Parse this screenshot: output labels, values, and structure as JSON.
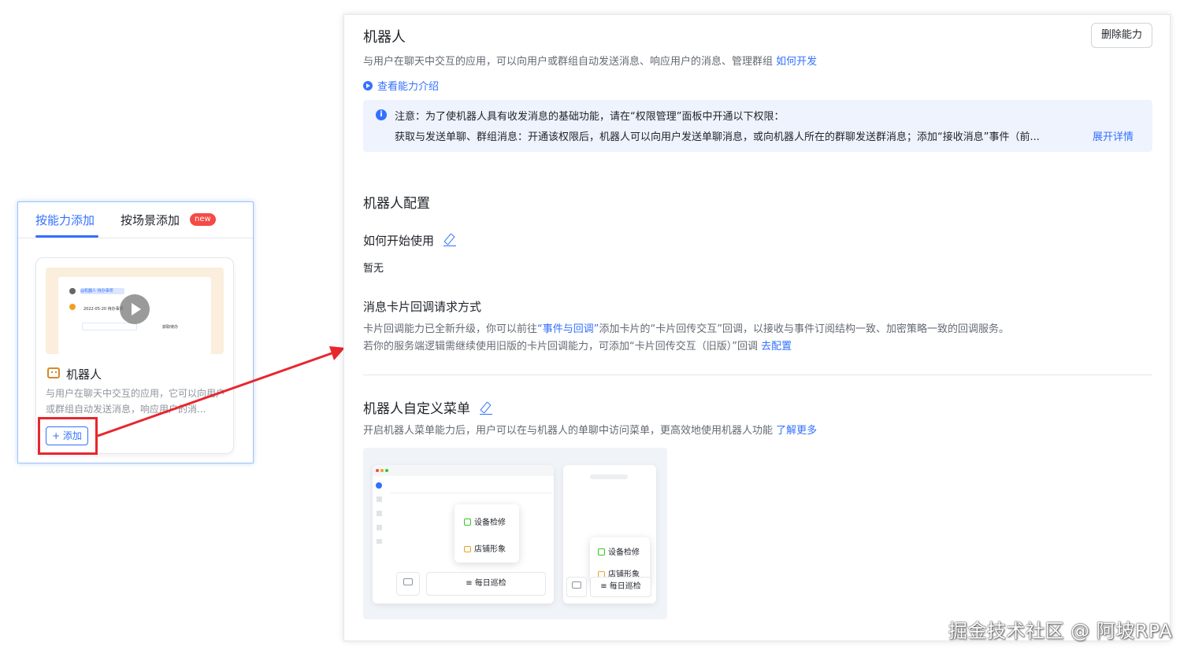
{
  "left": {
    "tabs": [
      {
        "label": "按能力添加"
      },
      {
        "label": "按场景添加",
        "badge": "new"
      }
    ],
    "card": {
      "title": "机器人",
      "desc": "与用户在聊天中交互的应用，它可以向用户或群组自动发送消息，响应用户的消...",
      "add_label": "+ 添加",
      "thumb": {
        "chip": "@机器人  待办事项",
        "date": "2022-05-20  待办事项",
        "right": "获取待办"
      }
    }
  },
  "main": {
    "title": "机器人",
    "delete_label": "删除能力",
    "subtitle": "与用户在聊天中交互的应用，可以向用户或群组自动发送消息、响应用户的消息、管理群组",
    "subtitle_link": "如何开发",
    "intro_link": "查看能力介绍",
    "notice": {
      "line1": "注意：为了使机器人具有收发消息的基础功能，请在“权限管理”面板中开通以下权限：",
      "line2": "获取与发送单聊、群组消息：开通该权限后，机器人可以向用户发送单聊消息，或向机器人所在的群聊发送群消息；添加“接收消息”事件（前...",
      "more": "展开详情"
    },
    "config_title": "机器人配置",
    "how_title": "如何开始使用",
    "how_value": "暂无",
    "callback_title": "消息卡片回调请求方式",
    "callback_text_a": "卡片回调能力已全新升级，你可以前往",
    "callback_link1": "“事件与回调”",
    "callback_text_b": "添加卡片的“卡片回传交互”回调，以接收与事件订阅结构一致、加密策略一致",
    "callback_text_c": "的回调服务。若你的服务端逻辑需继续使用旧版的卡片回调能力，可添加“卡片回传交互（旧版）”回调",
    "callback_link2": "去配置",
    "menu_title": "机器人自定义菜单",
    "menu_desc": "开启机器人菜单能力后，用户可以在与机器人的单聊中访问菜单，更高效地使用机器人功能",
    "menu_link": "了解更多",
    "preview": {
      "item1": "设备检修",
      "item2": "店铺形象",
      "item3": "每日巡检"
    }
  },
  "watermark": "掘金技术社区 @ 阿坡RPA",
  "colors": {
    "accent": "#3370ff",
    "annotation": "#e8262d"
  }
}
